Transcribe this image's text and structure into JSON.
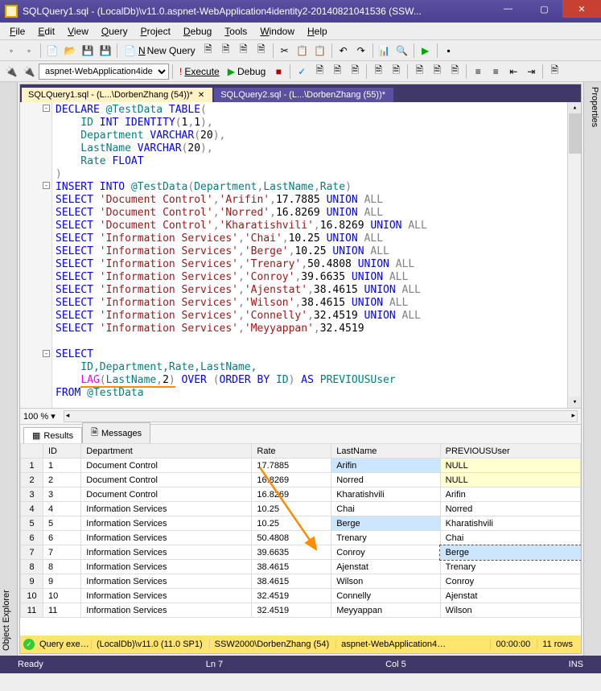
{
  "window": {
    "title": "SQLQuery1.sql - (LocalDb)\\v11.0.aspnet-WebApplication4identity2-20140821041536 (SSW..."
  },
  "menu": {
    "items": [
      "File",
      "Edit",
      "View",
      "Query",
      "Project",
      "Debug",
      "Tools",
      "Window",
      "Help"
    ]
  },
  "toolbar1": {
    "newquery": "New Query"
  },
  "toolbar2": {
    "db": "aspnet-WebApplication4ide",
    "execute": "Execute",
    "debug": "Debug"
  },
  "side": {
    "left": "Object Explorer",
    "right": "Properties"
  },
  "tabs": {
    "active": "SQLQuery1.sql - (L...\\DorbenZhang (54))*",
    "other": "SQLQuery2.sql - (L...\\DorbenZhang (55))*"
  },
  "code": {
    "l1a": "DECLARE",
    "l1b": " @TestData ",
    "l1c": "TABLE",
    "l1d": "(",
    "l2a": "    ID ",
    "l2b": "INT IDENTITY",
    "l2c": "(",
    "l2d": "1",
    "l2e": ",",
    "l2f": "1",
    "l2g": "),",
    "l3a": "    Department ",
    "l3b": "VARCHAR",
    "l3c": "(",
    "l3d": "20",
    "l3e": "),",
    "l4a": "    LastName ",
    "l4b": "VARCHAR",
    "l4c": "(",
    "l4d": "20",
    "l4e": "),",
    "l5a": "    Rate ",
    "l5b": "FLOAT",
    "l6a": ")",
    "l7a": "INSERT INTO",
    "l7b": " @TestData",
    "l7c": "(",
    "l7d": "Department",
    "l7e": ",",
    "l7f": "LastName",
    "l7g": ",",
    "l7h": "Rate",
    "l7i": ")",
    "s": "SELECT ",
    "u": " UNION ",
    "a": "ALL",
    "r1a": "'Document Control'",
    "r1b": "'Arifin'",
    "r1c": "17.7885",
    "r2a": "'Document Control'",
    "r2b": "'Norred'",
    "r2c": "16.8269",
    "r3a": "'Document Control'",
    "r3b": "'Kharatishvili'",
    "r3c": "16.8269",
    "r4a": "'Information Services'",
    "r4b": "'Chai'",
    "r4c": "10.25",
    "r5a": "'Information Services'",
    "r5b": "'Berge'",
    "r5c": "10.25",
    "r6a": "'Information Services'",
    "r6b": "'Trenary'",
    "r6c": "50.4808",
    "r7a": "'Information Services'",
    "r7b": "'Conroy'",
    "r7c": "39.6635",
    "r8a": "'Information Services'",
    "r8b": "'Ajenstat'",
    "r8c": "38.4615",
    "r9a": "'Information Services'",
    "r9b": "'Wilson'",
    "r9c": "38.4615",
    "r10a": "'Information Services'",
    "r10b": "'Connelly'",
    "r10c": "32.4519",
    "r11a": "'Information Services'",
    "r11b": "'Meyyappan'",
    "r11c": "32.4519",
    "sel": "SELECT",
    "selcols": "    ID,Department,Rate,LastName,",
    "lag1": "    ",
    "lag2": "LAG",
    "lag3": "(",
    "lag4": "LastName",
    "lag5": ",",
    "lag6": "2",
    "lag7": ")",
    "lag8": " OVER ",
    "lag9": "(",
    "lag10": "ORDER BY",
    "lag11": " ID",
    "lag12": ")",
    "lag13": " AS ",
    "lag14": "PREVIOUSUser",
    "from1": "FROM",
    "from2": " @TestData"
  },
  "zoom": "100 %",
  "resultTabs": {
    "results": "Results",
    "messages": "Messages"
  },
  "grid": {
    "headers": [
      "",
      "ID",
      "Department",
      "Rate",
      "LastName",
      "PREVIOUSUser"
    ],
    "rows": [
      [
        "1",
        "1",
        "Document Control",
        "17.7885",
        "Arifin",
        "NULL"
      ],
      [
        "2",
        "2",
        "Document Control",
        "16.8269",
        "Norred",
        "NULL"
      ],
      [
        "3",
        "3",
        "Document Control",
        "16.8269",
        "Kharatishvili",
        "Arifin"
      ],
      [
        "4",
        "4",
        "Information Services",
        "10.25",
        "Chai",
        "Norred"
      ],
      [
        "5",
        "5",
        "Information Services",
        "10.25",
        "Berge",
        "Kharatishvili"
      ],
      [
        "6",
        "6",
        "Information Services",
        "50.4808",
        "Trenary",
        "Chai"
      ],
      [
        "7",
        "7",
        "Information Services",
        "39.6635",
        "Conroy",
        "Berge"
      ],
      [
        "8",
        "8",
        "Information Services",
        "38.4615",
        "Ajenstat",
        "Trenary"
      ],
      [
        "9",
        "9",
        "Information Services",
        "38.4615",
        "Wilson",
        "Conroy"
      ],
      [
        "10",
        "10",
        "Information Services",
        "32.4519",
        "Connelly",
        "Ajenstat"
      ],
      [
        "11",
        "11",
        "Information Services",
        "32.4519",
        "Meyyappan",
        "Wilson"
      ]
    ]
  },
  "statusYellow": {
    "query": "Query exe…",
    "server": "(LocalDb)\\v11.0 (11.0 SP1)",
    "user": "SSW2000\\DorbenZhang (54)",
    "db": "aspnet-WebApplication4…",
    "time": "00:00:00",
    "rows": "11 rows"
  },
  "statusBlue": {
    "ready": "Ready",
    "ln": "Ln 7",
    "col": "Col 5",
    "ins": "INS"
  }
}
